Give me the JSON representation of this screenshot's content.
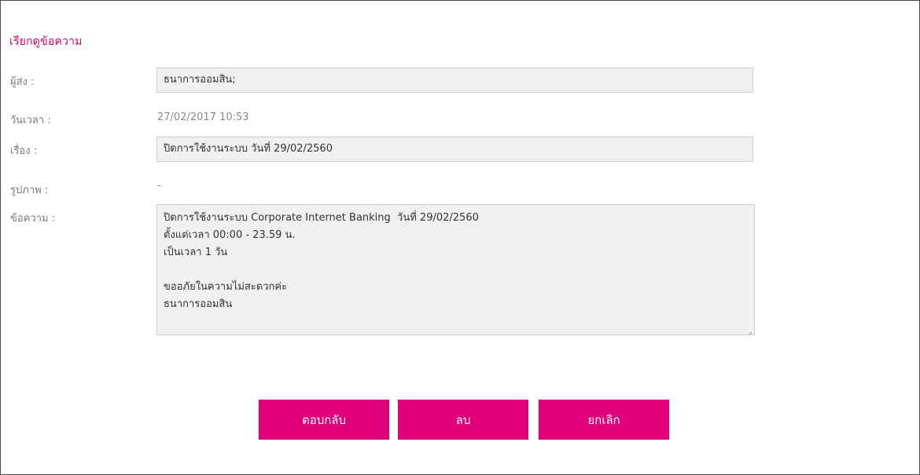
{
  "page": {
    "title": "เรียกดูข้อความ"
  },
  "form": {
    "sender": {
      "label": "ผู้ส่ง :",
      "value": "ธนาการออมสิน;"
    },
    "datetime": {
      "label": "วันเวลา :",
      "value": "27/02/2017 10:53"
    },
    "subject": {
      "label": "เรื่อง :",
      "value": "ปิดการใช้งานระบบ วันที่ 29/02/2560"
    },
    "image": {
      "label": "รูปภาพ :",
      "value": "-"
    },
    "message": {
      "label": "ข้อความ :",
      "lines": [
        "ปิดการใช้งานระบบ Corporate Internet Banking  วันที่ 29/02/2560",
        "ตั้งแต่เวลา 00:00 - 23.59 น.",
        "เป็นเวลา 1 วัน",
        "",
        "ขออภัยในความไม่สะดวกค่ะ",
        "ธนาการออมสิน"
      ]
    }
  },
  "actions": {
    "reply_label": "ตอบกลับ",
    "delete_label": "ลบ",
    "cancel_label": "ยกเลิก"
  },
  "colors": {
    "accent": "#e0007a",
    "title": "#d6006e",
    "field_bg": "#f0f0f0",
    "label": "#7a7a7a"
  }
}
